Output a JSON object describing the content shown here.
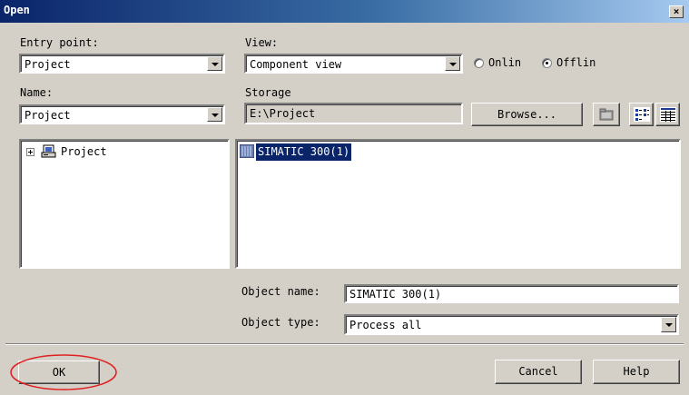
{
  "window": {
    "title": "Open",
    "close_glyph": "×"
  },
  "entry_point": {
    "label": "Entry point:",
    "value": "Project"
  },
  "view": {
    "label": "View:",
    "value": "Component view",
    "radio_online_label": "Onlin",
    "radio_offline_label": "Offlin",
    "selected": "offline"
  },
  "name": {
    "label": "Name:",
    "value": "Project"
  },
  "storage": {
    "label": "Storage",
    "value": "E:\\Project",
    "browse_label": "Browse..."
  },
  "tree": {
    "root_label": "Project",
    "expander": "⊞"
  },
  "objects": {
    "items": [
      {
        "label": "SIMATIC 300(1)"
      }
    ]
  },
  "object_name": {
    "label": "Object name:",
    "value": "SIMATIC 300(1)"
  },
  "object_type": {
    "label": "Object type:",
    "value": "Process all"
  },
  "buttons": {
    "ok": "OK",
    "cancel": "Cancel",
    "help": "Help"
  },
  "colors": {
    "selection": "#0a246a",
    "highlight_ring": "#e02020",
    "face": "#d4d0c8"
  },
  "icons": [
    "close-icon",
    "dropdown-arrow-icon",
    "expand-plus-icon",
    "project-icon",
    "station-icon",
    "folder-icon",
    "list-view-icon",
    "details-view-icon"
  ]
}
